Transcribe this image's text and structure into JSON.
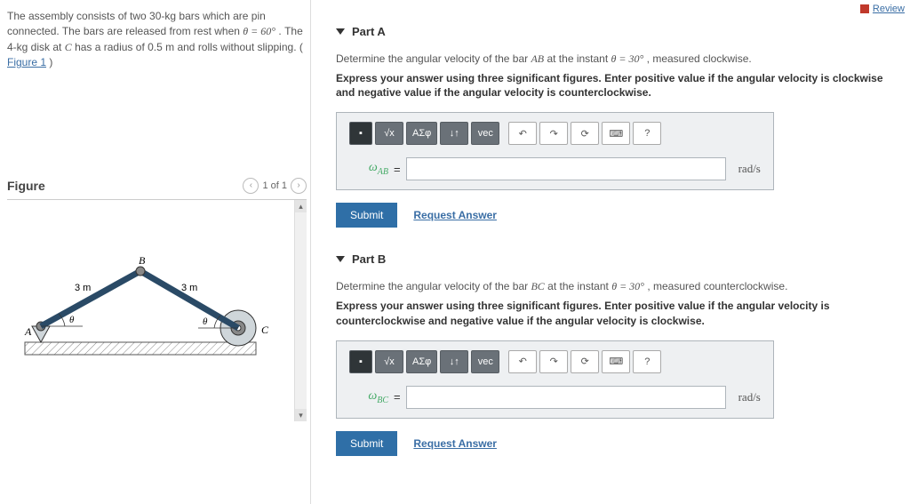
{
  "review": {
    "label": "Review"
  },
  "problem": {
    "text1": "The assembly consists of two 30-kg bars which are pin connected. The bars are released from rest when ",
    "theta1": "θ = 60°",
    "text2": ". The 4-kg disk at ",
    "cvar": "C",
    "text3": " has a radius of 0.5 m and rolls without slipping. (",
    "figlink": "Figure 1",
    "text4": ")"
  },
  "figure": {
    "title": "Figure",
    "counter": "1 of 1",
    "labels": {
      "B": "B",
      "A": "A",
      "C": "C",
      "len": "3 m",
      "theta": "θ"
    }
  },
  "partA": {
    "title": "Part A",
    "q1": "Determine the angular velocity of the bar ",
    "bar": "AB",
    "q2": " at the instant ",
    "cond": "θ = 30°",
    "q3": " , measured clockwise.",
    "instr": "Express your answer using three significant figures. Enter positive value if the angular velocity is clockwise and negative value if the angular velocity is counterclockwise.",
    "var": "ω",
    "sub": "AB",
    "unit": "rad/s",
    "submit": "Submit",
    "request": "Request Answer",
    "toolbar": {
      "greek": "ΑΣφ",
      "vec": "vec",
      "q": "?"
    }
  },
  "partB": {
    "title": "Part B",
    "q1": "Determine the angular velocity of the bar ",
    "bar": "BC",
    "q2": " at the instant ",
    "cond": "θ = 30°",
    "q3": " , measured counterclockwise.",
    "instr": "Express your answer using three significant figures. Enter positive value if the angular velocity is counterclockwise and negative value if the angular velocity is clockwise.",
    "var": "ω",
    "sub": "BC",
    "unit": "rad/s",
    "submit": "Submit",
    "request": "Request Answer"
  }
}
